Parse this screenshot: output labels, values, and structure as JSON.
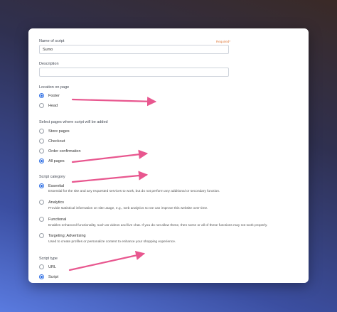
{
  "script_name": {
    "label": "Name of script",
    "required": "Required*",
    "value": "Sumo"
  },
  "description": {
    "label": "Description",
    "value": ""
  },
  "location": {
    "label": "Location on page",
    "options": [
      {
        "label": "Footer",
        "checked": true
      },
      {
        "label": "Head",
        "checked": false
      }
    ]
  },
  "pages": {
    "label": "Select pages where script will be added",
    "options": [
      {
        "label": "Store pages",
        "checked": false
      },
      {
        "label": "Checkout",
        "checked": false
      },
      {
        "label": "Order confirmation",
        "checked": false
      },
      {
        "label": "All pages",
        "checked": true
      }
    ]
  },
  "category": {
    "label": "Script category",
    "options": [
      {
        "label": "Essential",
        "checked": true,
        "description": "Essential for the site and any requested services to work, but do not perform any additional or secondary function."
      },
      {
        "label": "Analytics",
        "checked": false,
        "description": "Provide statistical information on site usage, e.g., web analytics so we can improve this website over time."
      },
      {
        "label": "Functional",
        "checked": false,
        "description": "Enables enhanced functionality, such as videos and live chat. If you do not allow these, then some or all of these functions may not work properly."
      },
      {
        "label": "Targeting; Advertising",
        "checked": false,
        "description": "Used to create profiles or personalize content to enhance your shopping experience."
      }
    ]
  },
  "script_type": {
    "label": "Script type",
    "options": [
      {
        "label": "URL",
        "checked": false
      },
      {
        "label": "Script",
        "checked": true
      }
    ]
  },
  "annotation_color": "#e8578f"
}
